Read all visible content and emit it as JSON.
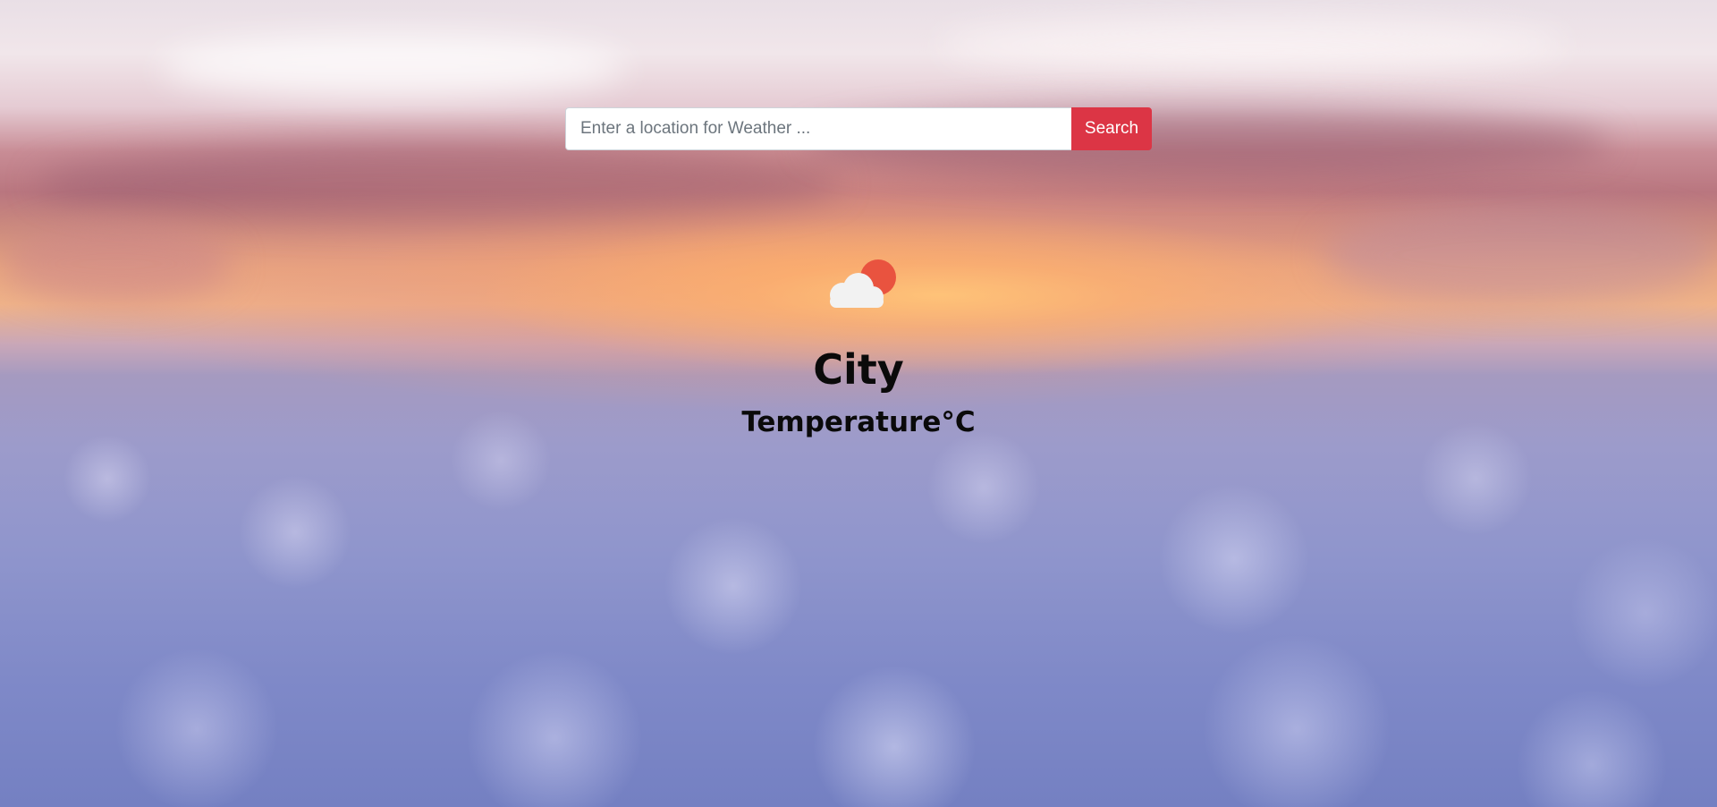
{
  "search": {
    "placeholder": "Enter a location for Weather ...",
    "value": "",
    "button_label": "Search",
    "button_color": "#dc3545"
  },
  "weather": {
    "icon": "partly-cloudy-icon",
    "icon_colors": {
      "cloud": "#f2f2f2",
      "sun": "#e9533f"
    },
    "city": "City",
    "temperature": "Temperature°C"
  }
}
